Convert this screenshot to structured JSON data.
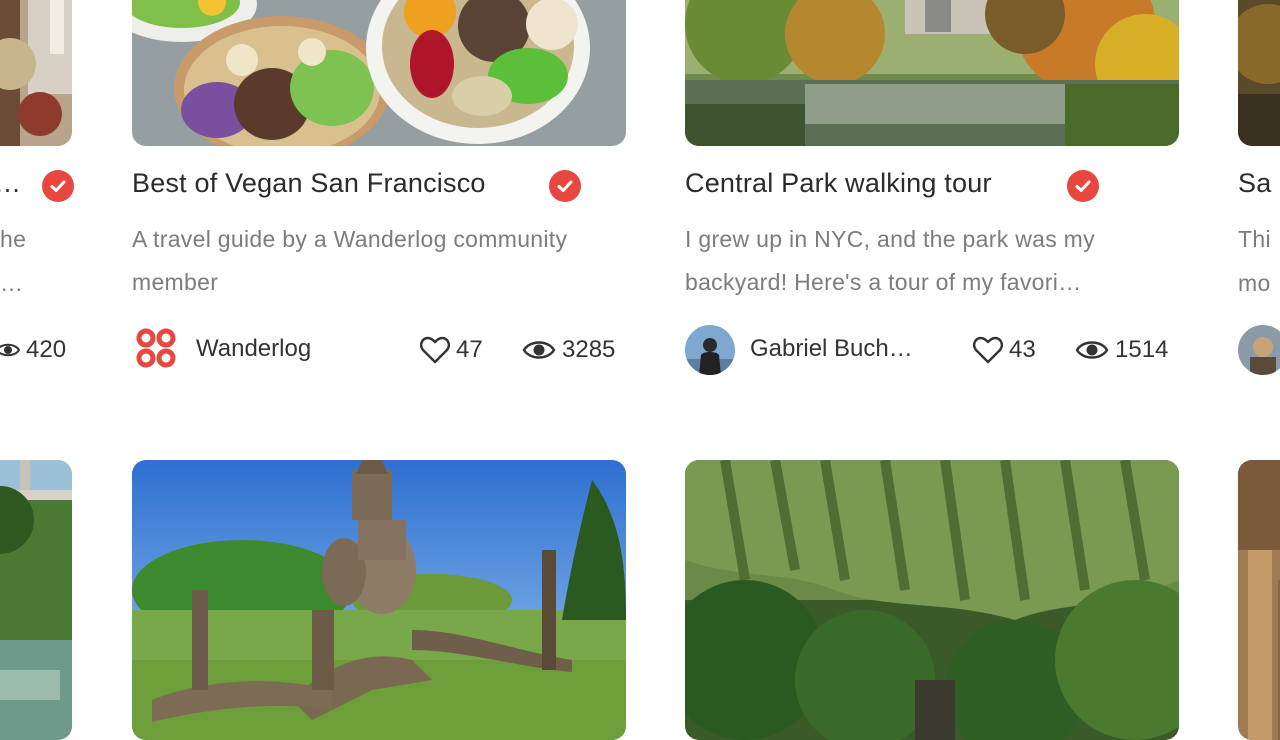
{
  "colors": {
    "verified": "#e8473f",
    "brand": "#e8473f",
    "text": "#2b2b2b",
    "muted": "#7c7c7c"
  },
  "cards": [
    {
      "title": "Best of Vegan San Francisco",
      "desc": "A travel guide by a Wanderlog community member",
      "author": "Wanderlog",
      "likes": "47",
      "views": "3285",
      "image": "vegan-bowls-photo"
    },
    {
      "title": "Central Park walking tour",
      "desc": "I grew up in NYC, and the park was my backyard! Here's a tour of my favori…",
      "author": "Gabriel Buch…",
      "likes": "43",
      "views": "1514",
      "image": "central-park-pond-photo"
    }
  ],
  "partial_left": {
    "title": "…",
    "desc_line1": "he",
    "desc_line2": "…",
    "views": "420"
  },
  "partial_right": {
    "title": "Sa",
    "desc_line1": "Thi",
    "desc_line2": "mo"
  },
  "row2": [
    {
      "image": "buddha-park-statues-photo"
    },
    {
      "image": "tropical-green-cliffs-photo"
    }
  ]
}
